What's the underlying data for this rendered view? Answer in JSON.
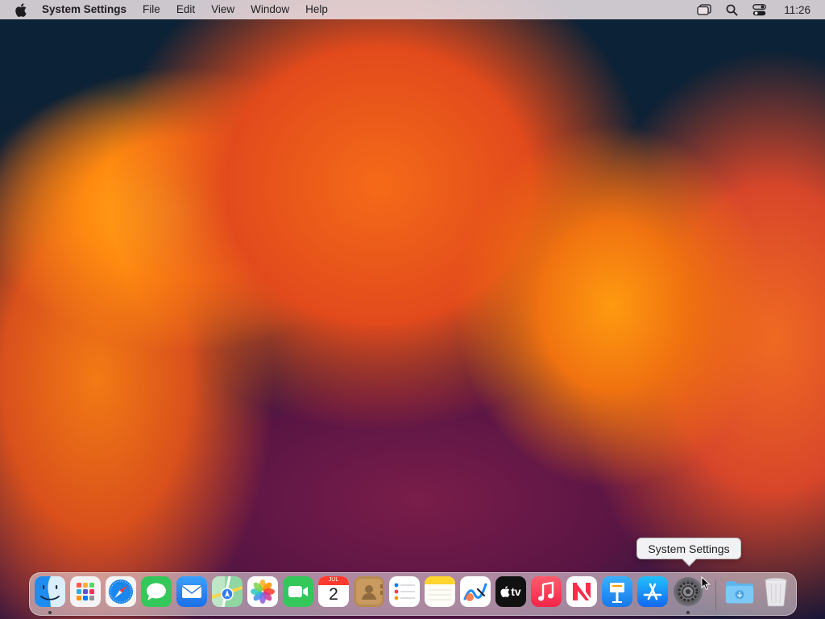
{
  "menubar": {
    "apple_icon": "apple-logo-icon",
    "app_name": "System Settings",
    "menus": [
      "File",
      "Edit",
      "View",
      "Window",
      "Help"
    ],
    "status_icons": [
      "screen-mirroring-icon",
      "spotlight-search-icon",
      "control-center-icon"
    ],
    "clock": "11:26"
  },
  "tooltip": {
    "text": "System Settings"
  },
  "dock": {
    "apps": [
      {
        "name": "Finder",
        "icon": "finder-icon",
        "running": true
      },
      {
        "name": "Launchpad",
        "icon": "launchpad-icon",
        "running": false
      },
      {
        "name": "Safari",
        "icon": "safari-icon",
        "running": false
      },
      {
        "name": "Messages",
        "icon": "messages-icon",
        "running": false
      },
      {
        "name": "Mail",
        "icon": "mail-icon",
        "running": false
      },
      {
        "name": "Maps",
        "icon": "maps-icon",
        "running": false
      },
      {
        "name": "Photos",
        "icon": "photos-icon",
        "running": false
      },
      {
        "name": "FaceTime",
        "icon": "facetime-icon",
        "running": false
      },
      {
        "name": "Calendar",
        "icon": "calendar-icon",
        "running": false,
        "month": "JUL",
        "day": "2"
      },
      {
        "name": "Contacts",
        "icon": "contacts-icon",
        "running": false
      },
      {
        "name": "Reminders",
        "icon": "reminders-icon",
        "running": false
      },
      {
        "name": "Notes",
        "icon": "notes-icon",
        "running": false
      },
      {
        "name": "Freeform",
        "icon": "freeform-icon",
        "running": false
      },
      {
        "name": "TV",
        "icon": "apple-tv-icon",
        "running": false,
        "label": "tv"
      },
      {
        "name": "Music",
        "icon": "music-icon",
        "running": false
      },
      {
        "name": "News",
        "icon": "news-icon",
        "running": false
      },
      {
        "name": "Keynote",
        "icon": "keynote-icon",
        "running": false
      },
      {
        "name": "App Store",
        "icon": "app-store-icon",
        "running": false
      },
      {
        "name": "System Settings",
        "icon": "system-settings-icon",
        "running": true
      }
    ],
    "extras": [
      {
        "name": "Downloads",
        "icon": "downloads-folder-icon"
      },
      {
        "name": "Trash",
        "icon": "trash-icon"
      }
    ]
  },
  "colors": {
    "menubar_bg": "#ece2e6",
    "dock_bg": "#eee8ec",
    "wallpaper_primary": "#f56a18",
    "wallpaper_dark": "#0c2236"
  }
}
